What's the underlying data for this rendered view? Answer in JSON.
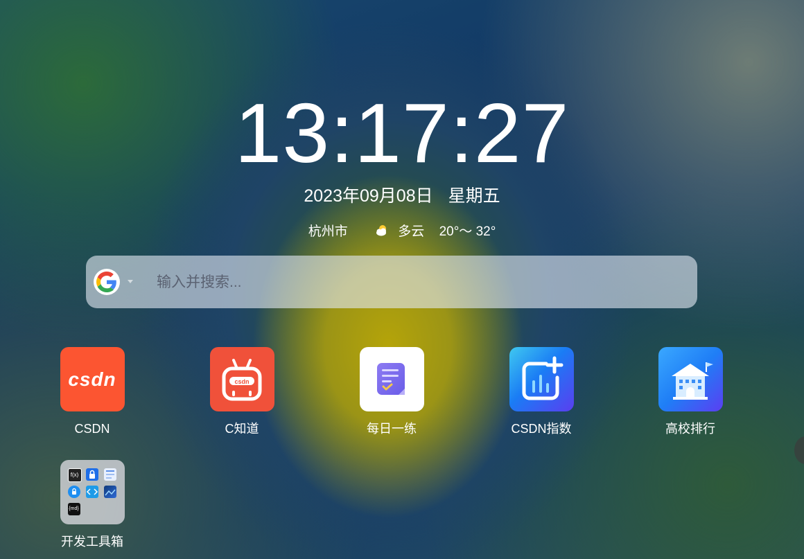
{
  "clock": {
    "time": "13:17:27"
  },
  "date": {
    "date_text": "2023年09月08日",
    "weekday": "星期五"
  },
  "weather": {
    "city": "杭州市",
    "icon": "partly-cloudy-icon",
    "condition": "多云",
    "temperature": "20°～ 32°"
  },
  "search": {
    "engine_icon": "google-icon",
    "placeholder": "输入并搜索..."
  },
  "apps": [
    {
      "label": "CSDN",
      "icon": "csdn-logo-icon",
      "color": "#fc5531"
    },
    {
      "label": "C知道",
      "icon": "robot-icon",
      "color": "#f0513a"
    },
    {
      "label": "每日一练",
      "icon": "notepad-icon",
      "color": "#ffffff"
    },
    {
      "label": "CSDN指数",
      "icon": "chart-plus-icon",
      "color": "#1a7cf5"
    },
    {
      "label": "高校排行",
      "icon": "school-icon",
      "color": "#1f7ef6"
    }
  ],
  "folder": {
    "label": "开发工具箱"
  },
  "logo_text": {
    "csdn": "csdn",
    "mini_fn": "f(x)",
    "mini_md": "{md}"
  }
}
